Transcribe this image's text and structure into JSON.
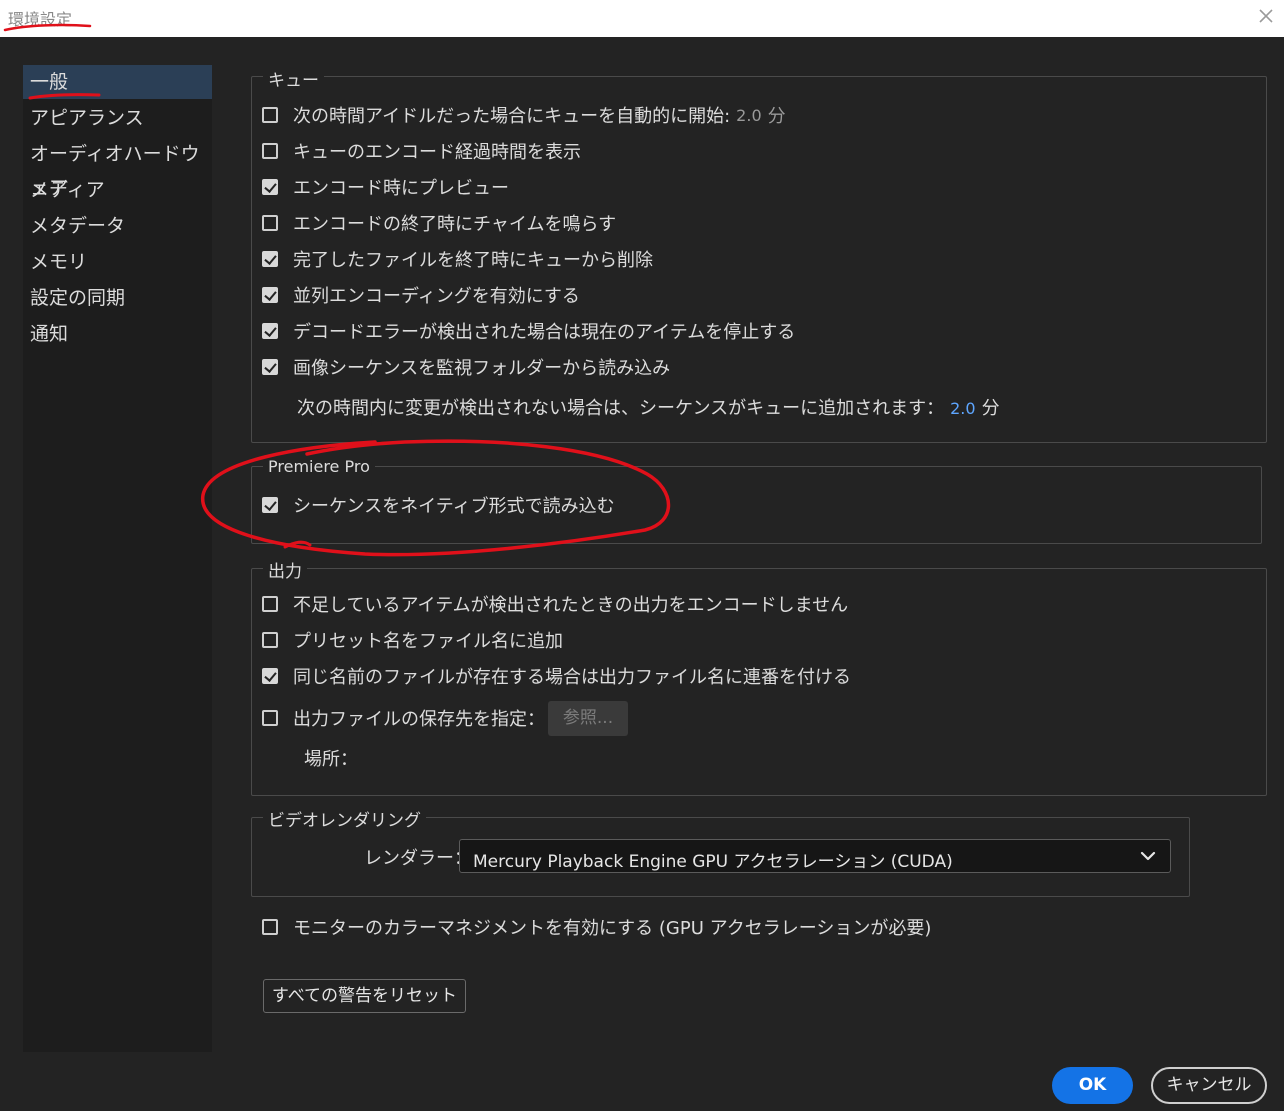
{
  "window": {
    "title": "環境設定"
  },
  "sidebar": {
    "items": [
      {
        "label": "一般",
        "active": true
      },
      {
        "label": "アピアランス"
      },
      {
        "label": "オーディオハードウェア"
      },
      {
        "label": "メディア"
      },
      {
        "label": "メタデータ"
      },
      {
        "label": "メモリ"
      },
      {
        "label": "設定の同期"
      },
      {
        "label": "通知"
      }
    ]
  },
  "queue": {
    "legend": "キュー",
    "items": [
      {
        "label": "次の時間アイドルだった場合にキューを自動的に開始:",
        "checked": false,
        "value": "2.0",
        "unit": "分"
      },
      {
        "label": "キューのエンコード経過時間を表示",
        "checked": false
      },
      {
        "label": "エンコード時にプレビュー",
        "checked": true
      },
      {
        "label": "エンコードの終了時にチャイムを鳴らす",
        "checked": false
      },
      {
        "label": "完了したファイルを終了時にキューから削除",
        "checked": true
      },
      {
        "label": "並列エンコーディングを有効にする",
        "checked": true
      },
      {
        "label": "デコードエラーが検出された場合は現在のアイテムを停止する",
        "checked": true
      },
      {
        "label": "画像シーケンスを監視フォルダーから読み込み",
        "checked": true
      }
    ],
    "sequence_note": {
      "label": "次の時間内に変更が検出されない場合は、シーケンスがキューに追加されます：",
      "value": "2.0",
      "unit": "分"
    }
  },
  "premiere": {
    "legend": "Premiere Pro",
    "items": [
      {
        "label": "シーケンスをネイティブ形式で読み込む",
        "checked": true
      }
    ]
  },
  "output": {
    "legend": "出力",
    "items": [
      {
        "label": "不足しているアイテムが検出されたときの出力をエンコードしません",
        "checked": false
      },
      {
        "label": "プリセット名をファイル名に追加",
        "checked": false
      },
      {
        "label": "同じ名前のファイルが存在する場合は出力ファイル名に連番を付ける",
        "checked": true
      },
      {
        "label": "出力ファイルの保存先を指定：",
        "checked": false
      }
    ],
    "browse_label": "参照...",
    "location_label": "場所："
  },
  "video": {
    "legend": "ビデオレンダリング",
    "renderer_label": "レンダラー：",
    "renderer_value": "Mercury Playback Engine GPU アクセラレーション (CUDA)"
  },
  "monitor": {
    "label": "モニターのカラーマネジメントを有効にする (GPU アクセラレーションが必要)",
    "checked": false
  },
  "buttons": {
    "reset": "すべての警告をリセット",
    "ok": "OK",
    "cancel": "キャンセル"
  },
  "colors": {
    "accent": "#1473e6",
    "annotation": "#e0101a",
    "selection": "#2b3f56",
    "background": "#232323"
  }
}
